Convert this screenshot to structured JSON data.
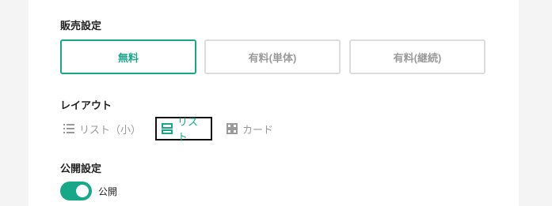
{
  "sales": {
    "title": "販売設定",
    "options": [
      {
        "label": "無料",
        "selected": true
      },
      {
        "label": "有料(単体)",
        "selected": false
      },
      {
        "label": "有料(継続)",
        "selected": false
      }
    ]
  },
  "layout": {
    "title": "レイアウト",
    "options": [
      {
        "label": "リスト（小）",
        "icon": "list-small-icon",
        "selected": false
      },
      {
        "label": "リスト",
        "icon": "list-icon",
        "selected": true
      },
      {
        "label": "カード",
        "icon": "grid-icon",
        "selected": false
      }
    ]
  },
  "visibility": {
    "title": "公開設定",
    "toggle_on": true,
    "toggle_label": "公開"
  },
  "colors": {
    "accent": "#17a88a",
    "inactive": "#9a9a9a",
    "border": "#dcdcdc"
  }
}
